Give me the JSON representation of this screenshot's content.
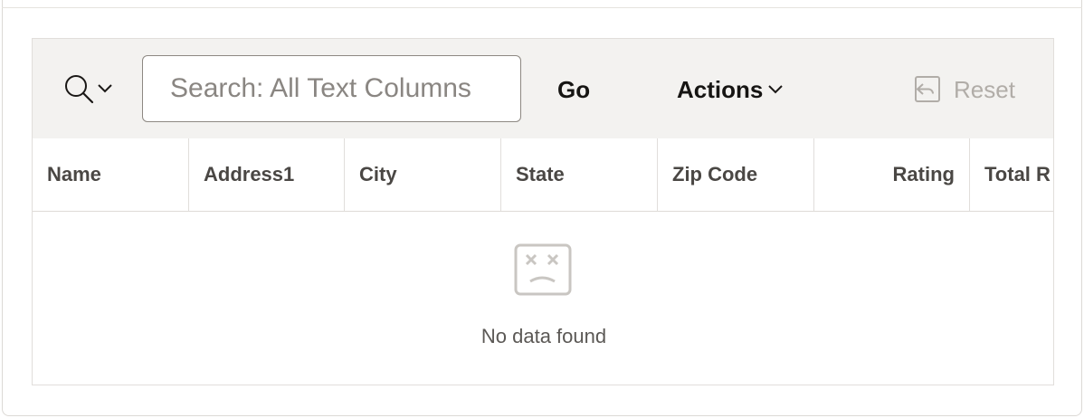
{
  "toolbar": {
    "search_menu_icon": "search-icon",
    "search_placeholder": "Search: All Text Columns",
    "go_label": "Go",
    "actions_label": "Actions",
    "reset_label": "Reset",
    "reset_icon": "undo-icon"
  },
  "columns": [
    {
      "label": "Name"
    },
    {
      "label": "Address1"
    },
    {
      "label": "City"
    },
    {
      "label": "State"
    },
    {
      "label": "Zip Code"
    },
    {
      "label": "Rating"
    },
    {
      "label": "Total R"
    }
  ],
  "empty_state": {
    "icon": "sad-face-icon",
    "message": "No data found"
  },
  "colors": {
    "toolbar_bg": "#f3f2f0",
    "text": "#161513",
    "disabled": "#b1ada8"
  }
}
